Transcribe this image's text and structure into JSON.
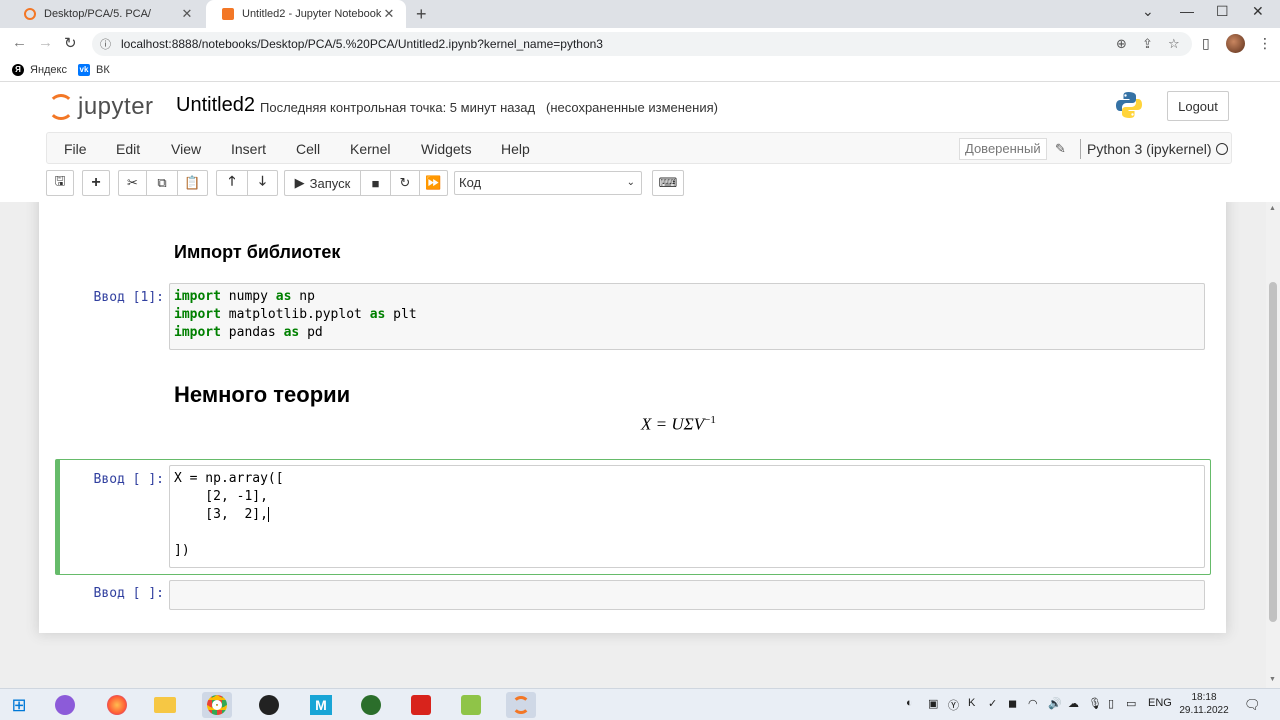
{
  "browser": {
    "tabs": [
      {
        "title": "Desktop/PCA/5. PCA/",
        "active": false
      },
      {
        "title": "Untitled2 - Jupyter Notebook",
        "active": true
      }
    ],
    "url": "localhost:8888/notebooks/Desktop/PCA/5.%20PCA/Untitled2.ipynb?kernel_name=python3",
    "bookmarks": [
      "Яндекс",
      "ВК"
    ]
  },
  "jupyter": {
    "logo_text": "jupyter",
    "notebook_name": "Untitled2",
    "checkpoint": "Последняя контрольная точка: 5 минут назад",
    "unsaved": "(несохраненные изменения)",
    "logout_label": "Logout",
    "menu": [
      "File",
      "Edit",
      "View",
      "Insert",
      "Cell",
      "Kernel",
      "Widgets",
      "Help"
    ],
    "trusted_label": "Доверенный",
    "kernel_name": "Python 3 (ipykernel)",
    "toolbar": {
      "run_label": "Запуск",
      "cell_type": "Код"
    }
  },
  "notebook": {
    "heading_imports": "Импорт библиотек",
    "cell1_prompt": "Ввод [1]:",
    "cell1_lines": [
      {
        "kw1": "import",
        "mod": " numpy ",
        "kw2": "as",
        "alias": " np"
      },
      {
        "kw1": "import",
        "mod": " matplotlib.pyplot ",
        "kw2": "as",
        "alias": " plt"
      },
      {
        "kw1": "import",
        "mod": " pandas ",
        "kw2": "as",
        "alias": " pd"
      }
    ],
    "heading_theory": "Немного теории",
    "formula": "X = UΣV",
    "formula_sup": "−1",
    "cell2_prompt": "Ввод [ ]:",
    "cell2_lines": [
      "X = np.array([",
      "    [2, -1],",
      "    [3,  2],",
      "",
      "])"
    ],
    "cell3_prompt": "Ввод [ ]:"
  },
  "taskbar": {
    "lang": "ENG",
    "time": "18:18",
    "date": "29.11.2022"
  }
}
